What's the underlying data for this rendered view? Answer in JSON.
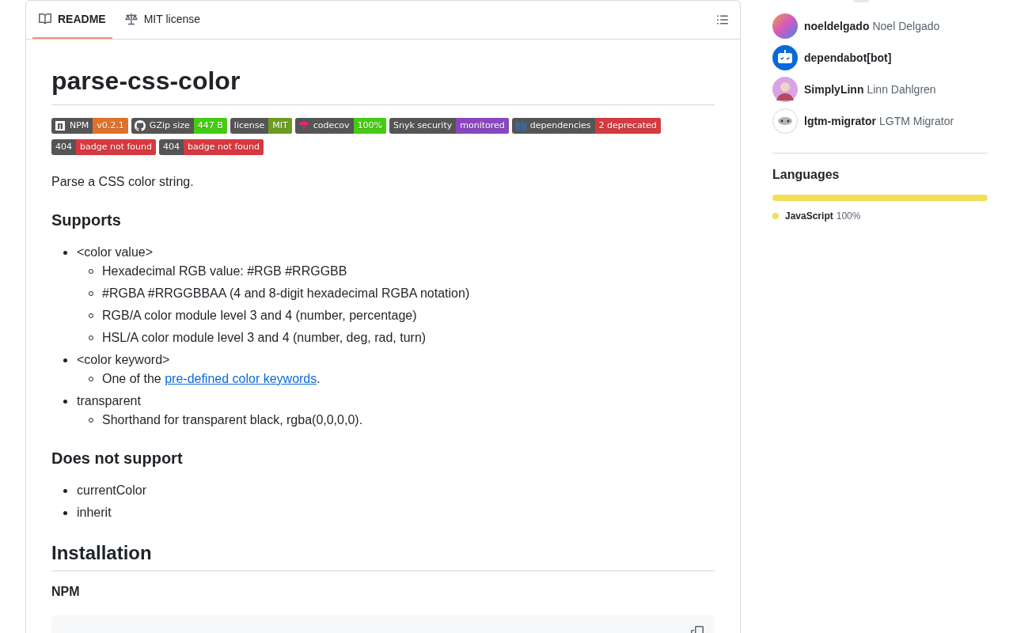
{
  "readme": {
    "tabs": [
      {
        "label": "README",
        "selected": true
      },
      {
        "label": "MIT license",
        "selected": false
      }
    ],
    "title": "parse-css-color",
    "badge_rows": [
      [
        {
          "label": "NPM",
          "value": "v0.2.1",
          "color": "#e0712b"
        },
        {
          "label": "GZip size",
          "value": "447 B",
          "color": "#44cc11"
        },
        {
          "label": "license",
          "value": "MIT",
          "color": "#6b9c1f"
        },
        {
          "label": "codecov",
          "value": "100%",
          "color": "#44cc11"
        },
        {
          "label": "Snyk security",
          "value": "monitored",
          "color": "#8a46c0"
        },
        {
          "label": "dependencies",
          "value": "2 deprecated",
          "color": "#d6393f"
        }
      ],
      [
        {
          "label": "404",
          "value": "badge not found",
          "color": "#d6393f"
        },
        {
          "label": "404",
          "value": "badge not found",
          "color": "#d6393f"
        }
      ]
    ],
    "intro": "Parse a CSS color string.",
    "sections": [
      {
        "heading": "Supports",
        "items": [
          {
            "text": "<color value>",
            "children": [
              {
                "text": "Hexadecimal RGB value: #RGB #RRGGBB"
              },
              {
                "text": "#RGBA #RRGGBBAA (4 and 8-digit hexadecimal RGBA notation)"
              },
              {
                "text": "RGB/A color module level 3 and 4 (number, percentage)"
              },
              {
                "text": "HSL/A color module level 3 and 4 (number, deg, rad, turn)"
              }
            ]
          },
          {
            "text": "<color keyword>",
            "children": [
              {
                "text": "One of the ",
                "link": "pre-defined color keywords",
                "after": "."
              }
            ]
          },
          {
            "text": "transparent",
            "children": [
              {
                "text": "Shorthand for transparent black, rgba(0,0,0,0)."
              }
            ]
          }
        ]
      },
      {
        "heading": "Does not support",
        "items": [
          {
            "text": "currentColor"
          },
          {
            "text": "inherit"
          }
        ]
      }
    ],
    "installation": {
      "heading": "Installation",
      "subheading": "NPM"
    }
  },
  "sidebar": {
    "contributors": [
      {
        "login": "noeldelgado",
        "name": "Noel Delgado"
      },
      {
        "login": "dependabot[bot]"
      },
      {
        "login": "SimplyLinn",
        "name": "Linn Dahlgren"
      },
      {
        "login": "lgtm-migrator",
        "name": "LGTM Migrator"
      }
    ],
    "languages": {
      "heading": "Languages",
      "items": [
        {
          "name": "JavaScript",
          "percent": "100%",
          "color": "#f1e05a",
          "level": 1
        }
      ]
    }
  }
}
